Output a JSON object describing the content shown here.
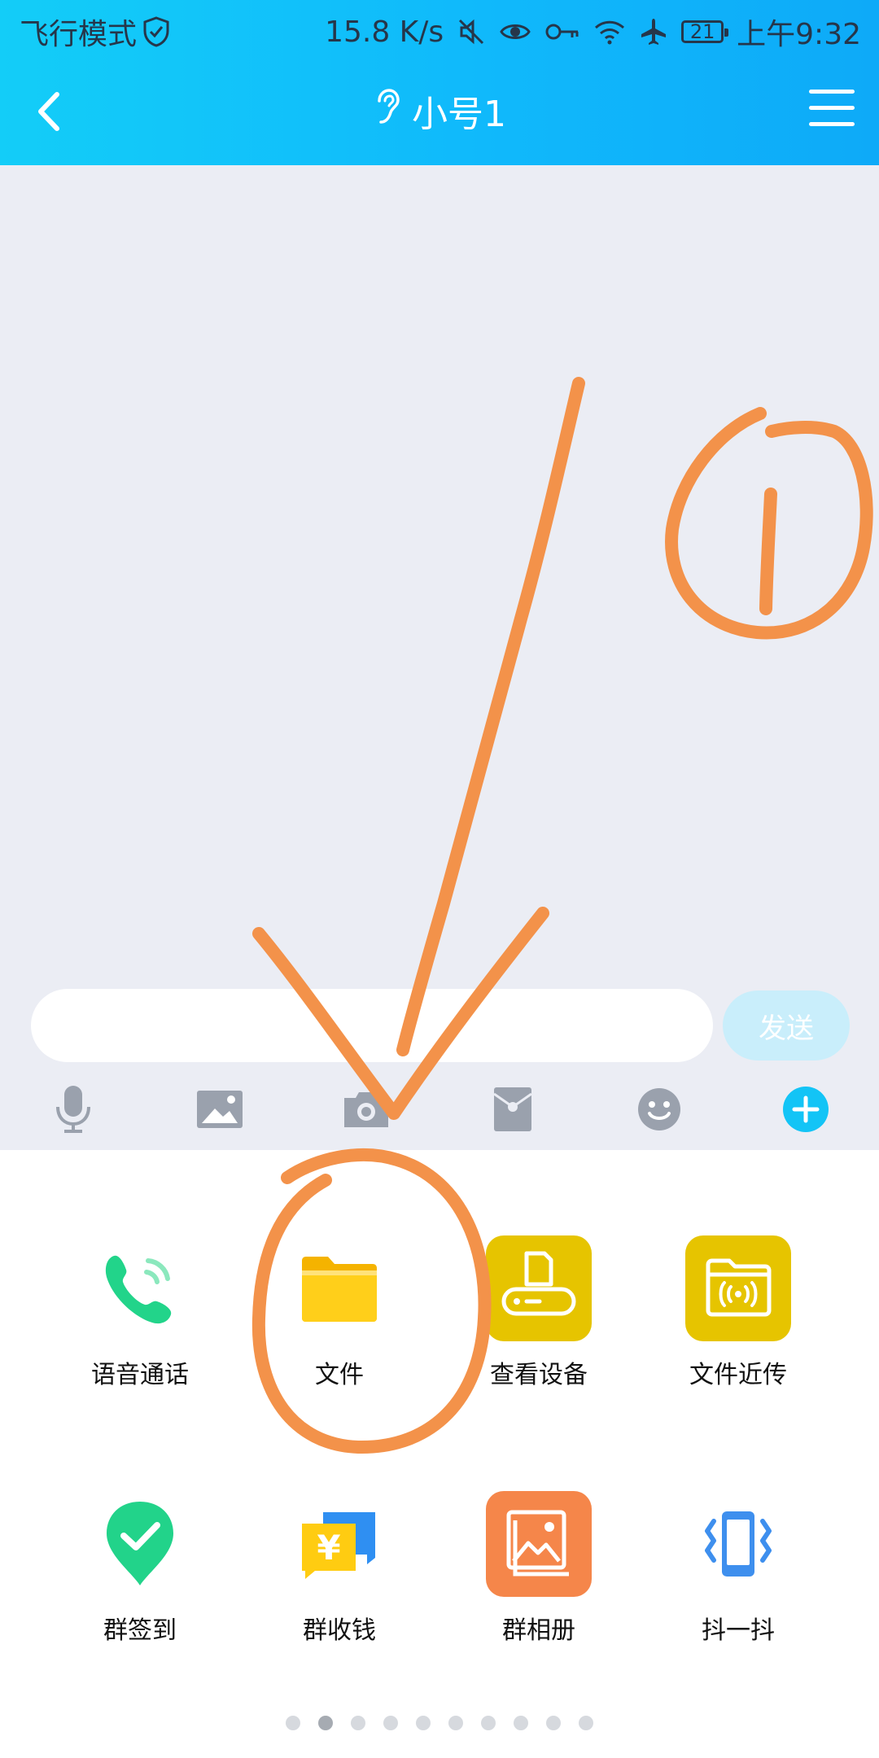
{
  "status_bar": {
    "mode_text": "飞行模式",
    "net_speed": "15.8 K/s",
    "battery_level": "21",
    "time": "上午9:32",
    "icons": [
      "shield-check-icon",
      "mute-icon",
      "eye-icon",
      "key-icon",
      "wifi-icon",
      "airplane-icon",
      "battery-icon"
    ]
  },
  "nav": {
    "title": "小号1",
    "icons": [
      "back-icon",
      "ear-icon",
      "menu-icon"
    ]
  },
  "composer": {
    "input_value": "",
    "send_label": "发送"
  },
  "toolbar": {
    "items": [
      "microphone-icon",
      "image-icon",
      "camera-icon",
      "red-packet-icon",
      "emoji-icon",
      "plus-icon"
    ]
  },
  "panel": {
    "items": [
      {
        "label": "语音通话",
        "icon": "phone-icon"
      },
      {
        "label": "文件",
        "icon": "folder-icon"
      },
      {
        "label": "查看设备",
        "icon": "printer-icon"
      },
      {
        "label": "文件近传",
        "icon": "nearby-file-icon"
      },
      {
        "label": "群签到",
        "icon": "check-in-icon"
      },
      {
        "label": "群收钱",
        "icon": "group-collect-icon"
      },
      {
        "label": "群相册",
        "icon": "album-icon"
      },
      {
        "label": "抖一抖",
        "icon": "shake-icon"
      }
    ],
    "page_count": 10,
    "current_page": 2
  },
  "annotation_text": "1",
  "colors": {
    "header": "#12befa",
    "accent": "#0ec7f3",
    "annotation": "#f3924a"
  }
}
